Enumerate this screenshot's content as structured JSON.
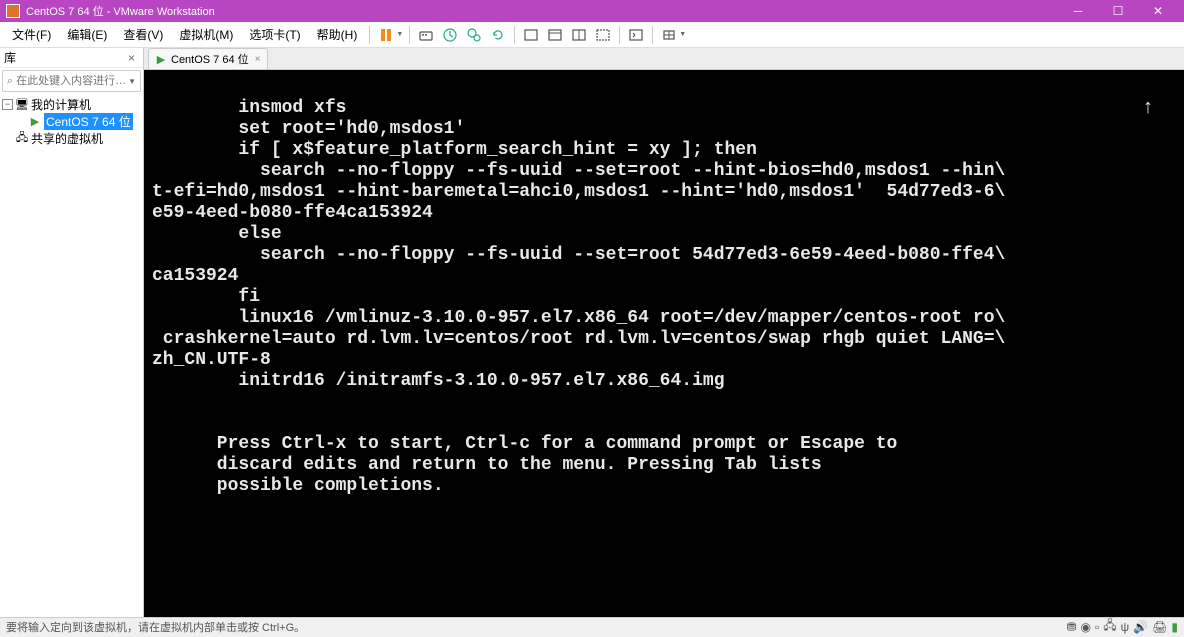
{
  "window": {
    "title": "CentOS 7 64 位 - VMware Workstation",
    "min_tip": "─",
    "max_tip": "☐",
    "close_tip": "✕"
  },
  "menus": {
    "file": "文件(F)",
    "edit": "编辑(E)",
    "view": "查看(V)",
    "vm": "虚拟机(M)",
    "tabs": "选项卡(T)",
    "help": "帮助(H)"
  },
  "sidebar": {
    "title": "库",
    "search_placeholder": "在此处键入内容进行…",
    "root": "我的计算机",
    "node_centos": "CentOS 7 64 位",
    "node_shared": "共享的虚拟机"
  },
  "tab": {
    "label": "CentOS 7 64 位"
  },
  "console": {
    "lines": [
      "        insmod xfs",
      "        set root='hd0,msdos1'",
      "        if [ x$feature_platform_search_hint = xy ]; then",
      "          search --no-floppy --fs-uuid --set=root --hint-bios=hd0,msdos1 --hin\\",
      "t-efi=hd0,msdos1 --hint-baremetal=ahci0,msdos1 --hint='hd0,msdos1'  54d77ed3-6\\",
      "e59-4eed-b080-ffe4ca153924",
      "        else",
      "          search --no-floppy --fs-uuid --set=root 54d77ed3-6e59-4eed-b080-ffe4\\",
      "ca153924",
      "        fi",
      "        linux16 /vmlinuz-3.10.0-957.el7.x86_64 root=/dev/mapper/centos-root ro\\",
      " crashkernel=auto rd.lvm.lv=centos/root rd.lvm.lv=centos/swap rhgb quiet LANG=\\",
      "zh_CN.UTF-8",
      "        initrd16 /initramfs-3.10.0-957.el7.x86_64.img",
      "",
      "",
      "      Press Ctrl-x to start, Ctrl-c for a command prompt or Escape to",
      "      discard edits and return to the menu. Pressing Tab lists",
      "      possible completions."
    ],
    "arrow": "↑"
  },
  "status": {
    "text": "要将输入定向到该虚拟机，请在虚拟机内部单击或按 Ctrl+G。"
  }
}
